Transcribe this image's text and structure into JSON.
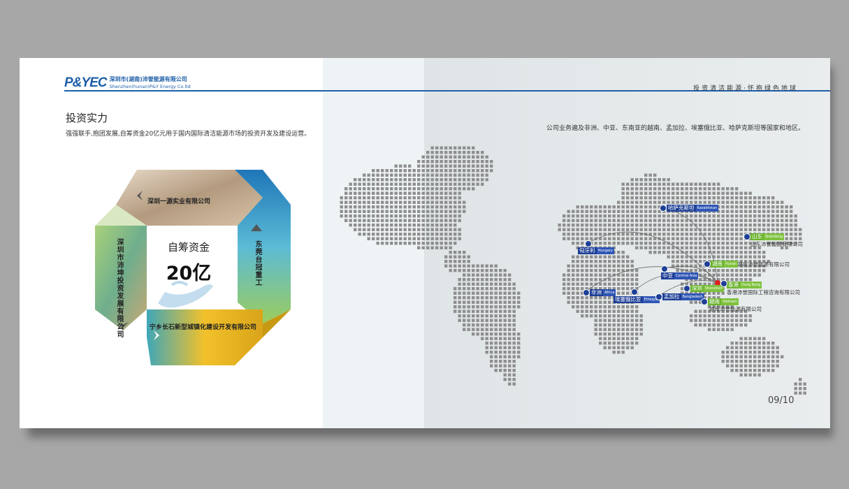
{
  "header": {
    "logo_mark": "P&YEC",
    "company_cn": "深圳市(湖南)沛誉能源有限公司",
    "company_en": "Shenzhen(hunan)P&Y Energy Co.ltd",
    "slogan": "投资清洁能源·怀抱绿色地球"
  },
  "left_page": {
    "heading": "投资实力",
    "intro": "强强联手,抱团发展,自筹资金20亿元用于国内国际清洁能源市场的投资开发及建设运营。",
    "center_title": "自筹资金",
    "center_amount": "20亿",
    "partners": {
      "top": "深圳一源实业有限公司",
      "right": "东莞台冠重工",
      "left": "深圳市沛坤投资发展有限公司",
      "bottom": "宁乡长石新型城镇化建设开发有限公司"
    },
    "colors": {
      "top": "#c9b39a",
      "right": "#2a8ec0",
      "left": "#8fc47a",
      "bottom": "#e3b521"
    }
  },
  "right_page": {
    "description": "公司业务遍及非洲、中亚、东南亚的越南、孟加拉、埃塞俄比亚、哈萨克斯坦等国家和地区。",
    "page_number": "09/10",
    "locations": [
      {
        "cn": "哈萨克斯坦",
        "en": "Kazakhstan",
        "color": "blue"
      },
      {
        "cn": "匈牙利",
        "en": "Hungary",
        "color": "blue"
      },
      {
        "cn": "山东",
        "en": "Shandong",
        "color": "green"
      },
      {
        "cn": "湖南",
        "en": "Hunan",
        "color": "green"
      },
      {
        "cn": "中亚",
        "en": "Central Asia",
        "color": "blue"
      },
      {
        "cn": "深圳",
        "en": "Shenzhen",
        "color": "green"
      },
      {
        "cn": "香港",
        "en": "Hong Kong",
        "color": "green"
      },
      {
        "cn": "非洲",
        "en": "Africa",
        "color": "blue"
      },
      {
        "cn": "埃塞俄比亚",
        "en": "Ethiopia",
        "color": "blue"
      },
      {
        "cn": "孟加拉",
        "en": "Bangladesh",
        "color": "blue"
      },
      {
        "cn": "越南",
        "en": "Vietnam",
        "color": "green"
      }
    ],
    "companies": {
      "shandong": "山东沛誉能源有限公司",
      "hunan": "湖南沛誉能源有限公司",
      "hongkong": "香港沛誉国际工程咨询有限公司",
      "vietnam": "越南沛誉能源有限公司"
    }
  }
}
